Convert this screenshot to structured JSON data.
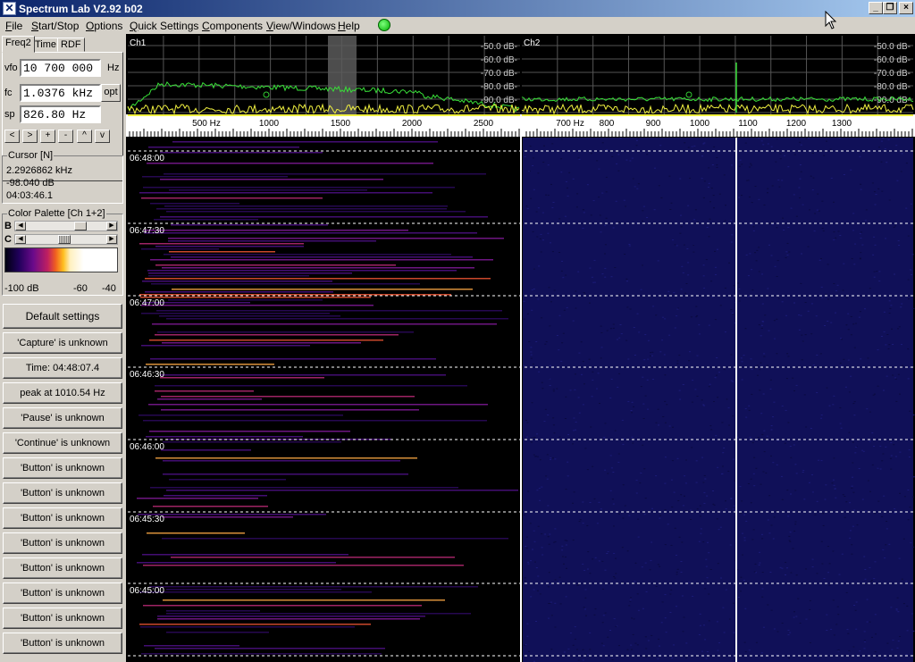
{
  "window": {
    "title": "Spectrum Lab V2.92 b02"
  },
  "window_controls": {
    "minimize": "_",
    "maximize": "❐",
    "close": "×"
  },
  "menu": {
    "items": [
      "File",
      "Start/Stop",
      "Options",
      "Quick Settings",
      "Components",
      "View/Windows",
      "Help"
    ]
  },
  "tabs": {
    "items": [
      "Freq2",
      "Time",
      "RDF"
    ],
    "active": "Freq2"
  },
  "freq": {
    "vfo_label": "vfo",
    "vfo_value": "10 700 000",
    "vfo_unit": "Hz",
    "fc_label": "fc",
    "fc_value": "1.0376 kHz",
    "opt_label": "opt",
    "sp_label": "sp",
    "sp_value": "826.80 Hz",
    "nav_buttons": [
      "<",
      ">",
      "+",
      "-",
      "^",
      "v"
    ]
  },
  "cursor": {
    "title": "Cursor [N]",
    "freq": "2.2926862 kHz",
    "level": "-98.040 dB",
    "time": "04:03:46.1"
  },
  "palette": {
    "title": "Color Palette [Ch 1+2]",
    "b_label": "B",
    "c_label": "C",
    "min": "-100 dB",
    "mid": "-60",
    "max": "-40"
  },
  "buttons": [
    "Default settings",
    "'Capture' is unknown",
    "Time:  04:48:07.4",
    "peak at 1010.54 Hz",
    "'Pause' is unknown",
    "'Continue' is unknown",
    "'Button' is unknown",
    "'Button' is unknown",
    "'Button' is unknown",
    "'Button' is unknown",
    "'Button' is unknown",
    "'Button' is unknown",
    "'Button' is unknown",
    "'Button' is unknown"
  ],
  "ch1": {
    "label": "Ch1",
    "db_labels": [
      "-50.0 dB",
      "-60.0 dB",
      "-70.0 dB",
      "-80.0 dB",
      "-90.0 dB"
    ],
    "freq_labels": [
      "500  Hz",
      "1000",
      "1500",
      "2000",
      "2500"
    ]
  },
  "ch2": {
    "label": "Ch2",
    "db_labels": [
      "-50.0 dB",
      "-60.0 dB",
      "-70.0 dB",
      "-80.0 dB",
      "-90.0 dB"
    ],
    "freq_labels": [
      "700  Hz",
      "800",
      "900",
      "1000",
      "1100",
      "1200",
      "1300"
    ]
  },
  "waterfall": {
    "times": [
      "06:48:00",
      "06:47:30",
      "06:47:00",
      "06:46:30",
      "06:46:00",
      "06:45:30",
      "06:45:00"
    ]
  },
  "colors": {
    "title_start": "#0a246a",
    "title_end": "#a6caf0",
    "spectrum_green": "#38e038",
    "spectrum_yellow": "#f0f040",
    "waterfall_bg": "#101058"
  }
}
